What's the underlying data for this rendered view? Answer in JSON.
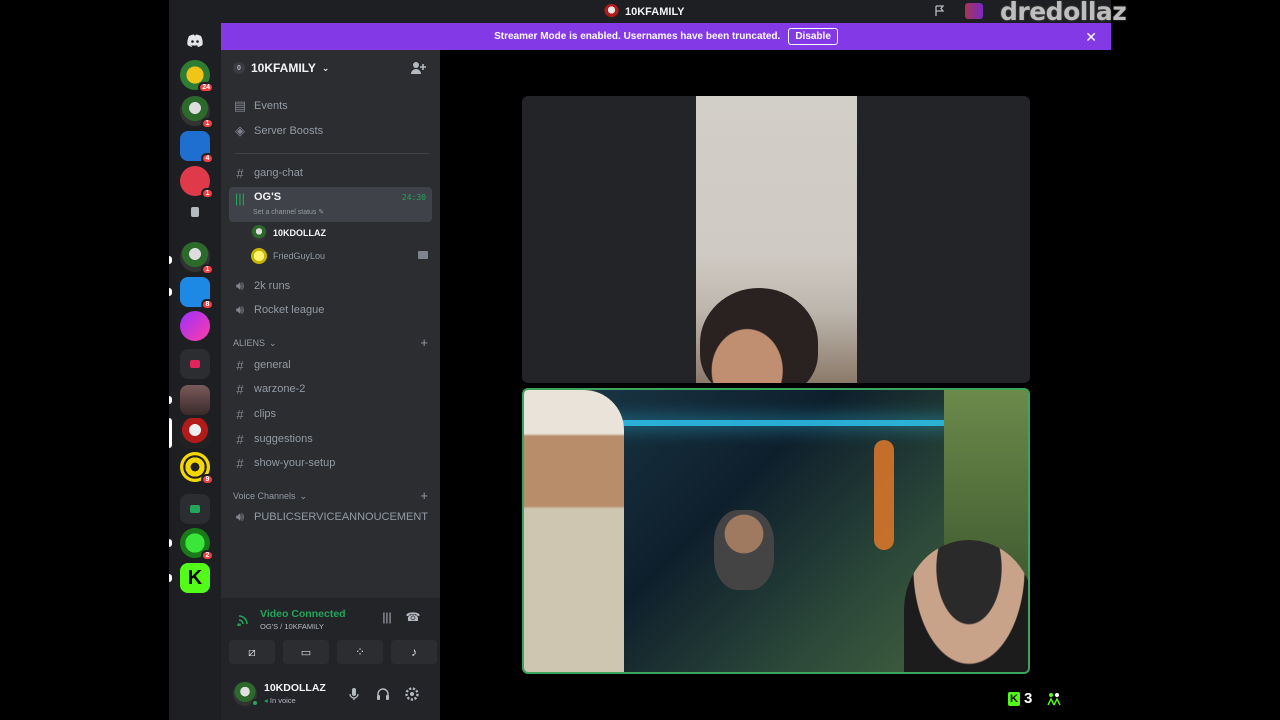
{
  "window": {
    "title": "10KFAMILY",
    "watermark": "dredollaz"
  },
  "banner": {
    "text": "Streamer Mode is enabled. Usernames have been truncated.",
    "button": "Disable"
  },
  "servers": [
    {
      "icon": "discord-home-icon"
    },
    {
      "icon": "server-icon",
      "badge": "24"
    },
    {
      "icon": "server-icon",
      "badge": "1"
    },
    {
      "icon": "server-icon",
      "badge": "4"
    },
    {
      "icon": "server-icon",
      "badge": "1"
    },
    {
      "icon": "server-icon"
    },
    {
      "icon": "server-icon",
      "badge": "1"
    },
    {
      "icon": "server-icon",
      "badge": "8"
    },
    {
      "icon": "server-icon"
    },
    {
      "icon": "server-icon",
      "badge": "9"
    },
    {
      "icon": "server-icon",
      "badge": "2"
    },
    {
      "icon": "kick-server-icon"
    }
  ],
  "guild": {
    "name": "10KFAMILY"
  },
  "nav": {
    "events": "Events",
    "boosts": "Server Boosts"
  },
  "channels": {
    "gang_chat": "gang-chat",
    "ogs": "OG'S",
    "ogs_status": "Set a channel status",
    "ogs_timer": "24:30",
    "members": [
      {
        "name": "10KDOLLAZ"
      },
      {
        "name": "FriedGuyLou"
      }
    ],
    "runs": "2k runs",
    "rocket": "Rocket league",
    "aliens_category": "ALIENS",
    "aliens": [
      "general",
      "warzone-2",
      "clips",
      "suggestions",
      "show-your-setup"
    ],
    "voice_category": "Voice Channels",
    "psa": "PUBLICSERVICEANNOUCEMENT"
  },
  "voice": {
    "status": "Video Connected",
    "location": "OG'S / 10KFAMILY"
  },
  "user": {
    "name": "10KDOLLAZ",
    "status": "In voice"
  },
  "overlay": {
    "kick_count": "3"
  }
}
